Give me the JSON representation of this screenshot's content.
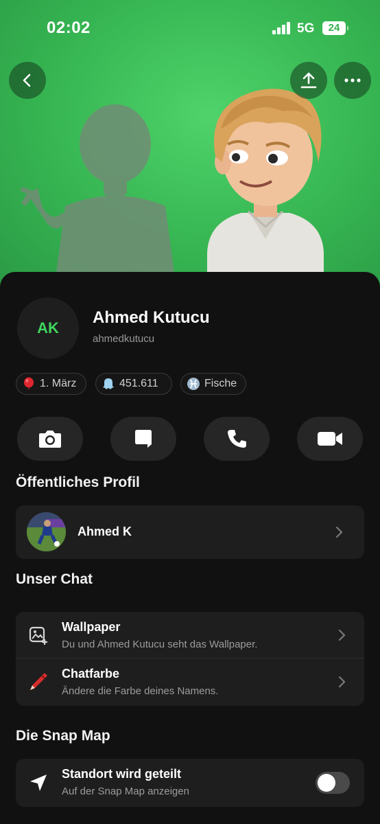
{
  "status": {
    "time": "02:02",
    "network": "5G",
    "battery": "24"
  },
  "colors": {
    "accent_green": "#3fd65e",
    "hero_green": "#36b552",
    "sheet_bg": "#111111",
    "card_bg": "#1e1e1e"
  },
  "icons": {
    "back": "chevron-left-icon",
    "share": "upload-icon",
    "more": "ellipsis-icon",
    "birthday": "balloon-icon",
    "score": "ghost-icon",
    "zodiac": "pisces-icon",
    "camera": "camera-icon",
    "chat": "chat-bubble-icon",
    "call": "phone-icon",
    "video": "video-camera-icon",
    "wallpaper": "wallpaper-icon",
    "chatcolor": "crayon-icon",
    "location": "location-arrow-icon"
  },
  "profile": {
    "initials": "AK",
    "name": "Ahmed Kutucu",
    "username": "ahmedkutucu",
    "chips": {
      "birthday": "1. März",
      "score": "451.611",
      "zodiac": "Fische"
    }
  },
  "public_profile": {
    "title": "Öffentliches Profil",
    "name": "Ahmed K"
  },
  "our_chat": {
    "title": "Unser Chat",
    "wallpaper": {
      "title": "Wallpaper",
      "subtitle": "Du und Ahmed Kutucu seht das Wallpaper."
    },
    "chat_color": {
      "title": "Chatfarbe",
      "subtitle": "Ändere die Farbe deines Namens."
    }
  },
  "snap_map": {
    "title": "Die Snap Map",
    "location": {
      "title": "Standort wird geteilt",
      "subtitle": "Auf der Snap Map anzeigen",
      "enabled": false
    }
  }
}
